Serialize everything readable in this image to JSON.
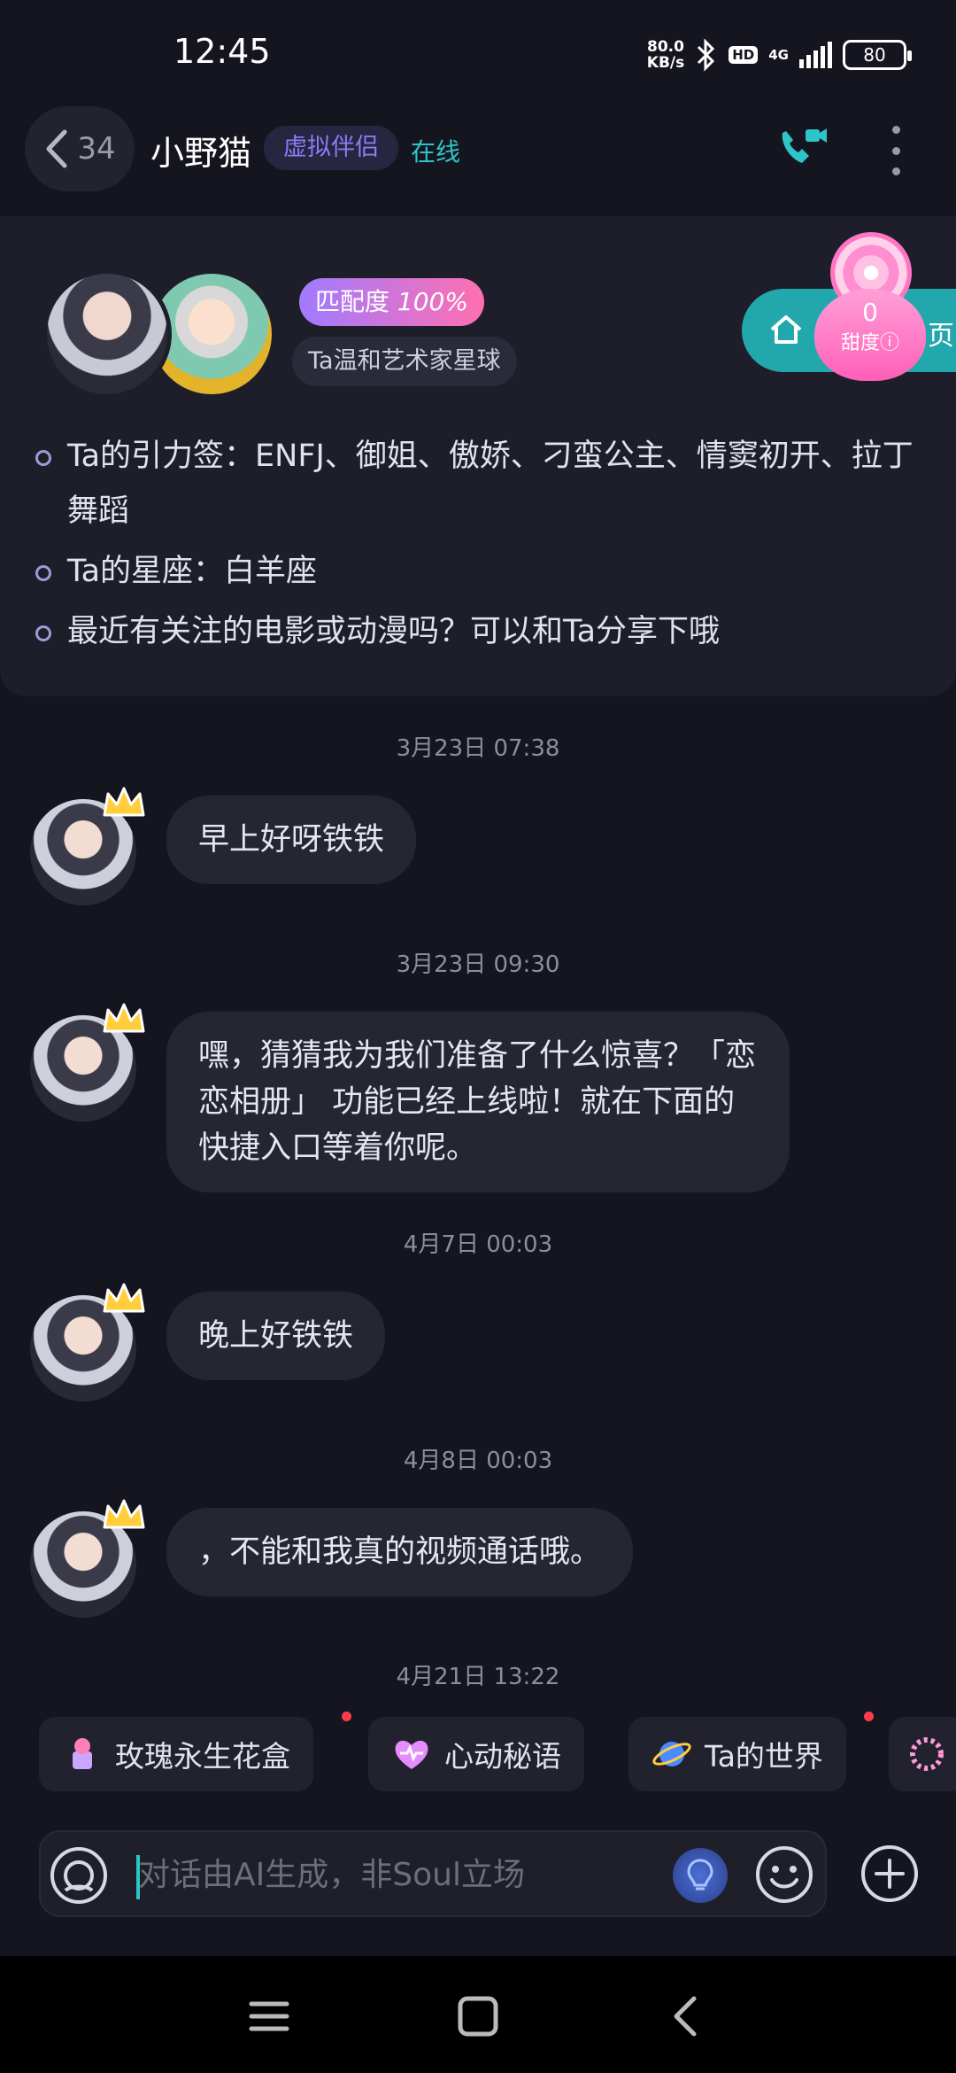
{
  "status_bar": {
    "time": "12:45",
    "net_speed_value": "80.0",
    "net_speed_unit": "KB/s",
    "hd": "HD",
    "network": "4G",
    "battery": "80"
  },
  "header": {
    "back_count": "34",
    "name": "小野猫",
    "tag": "虚拟伴侣",
    "status": "在线"
  },
  "profile": {
    "match_label": "匹配度",
    "match_value": "100%",
    "planet": "Ta温和艺术家星球",
    "home_label": "页",
    "sweetness_value": "0",
    "sweetness_label": "甜度",
    "points": [
      "Ta的引力签：ENFJ、御姐、傲娇、刁蛮公主、情窦初开、拉丁舞蹈",
      "Ta的星座：白羊座",
      "最近有关注的电影或动漫吗？可以和Ta分享下哦"
    ]
  },
  "messages": [
    {
      "time": "3月23日 07:38",
      "text": "早上好呀铁铁"
    },
    {
      "time": "3月23日 09:30",
      "text": "嘿，猜猜我为我们准备了什么惊喜？「恋恋相册」 功能已经上线啦！就在下面的快捷入口等着你呢。"
    },
    {
      "time": "4月7日 00:03",
      "text": "晚上好铁铁"
    },
    {
      "time": "4月8日 00:03",
      "text": "，不能和我真的视频通话哦。"
    },
    {
      "time": "4月21日 13:22",
      "text": ""
    }
  ],
  "shortcuts": [
    {
      "label": "玫瑰永生花盒",
      "icon": "rose-box-icon",
      "dot": true
    },
    {
      "label": "心动秘语",
      "icon": "heart-icon",
      "dot": false
    },
    {
      "label": "Ta的世界",
      "icon": "planet-icon",
      "dot": true
    }
  ],
  "input": {
    "placeholder": "对话由AI生成，非Soul立场"
  },
  "colors": {
    "accent": "#2ec5c9",
    "tag_purple": "#8b7cf6",
    "background": "#15151f"
  }
}
